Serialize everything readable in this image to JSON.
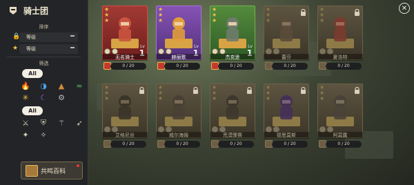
{
  "header": {
    "title": "骑士团"
  },
  "sort": {
    "section_label": "排序",
    "options": [
      {
        "label": "等级"
      },
      {
        "label": "等级"
      }
    ]
  },
  "filter": {
    "section_label": "筛选",
    "all_label_1": "All",
    "all_label_2": "All"
  },
  "wiki_button": {
    "label": "共鸣百科"
  },
  "cards": [
    {
      "name": "无名骑士",
      "level": "1",
      "progress": "0 / 20",
      "rarity": "red",
      "locked": false
    },
    {
      "name": "赫丽歌",
      "level": "1",
      "progress": "0 / 20",
      "rarity": "purple",
      "locked": false
    },
    {
      "name": "杰克逊",
      "level": "1",
      "progress": "0 / 20",
      "rarity": "green",
      "locked": false
    },
    {
      "name": "蕾芬",
      "progress": "0 / 20",
      "locked": true
    },
    {
      "name": "夏洛特",
      "progress": "0 / 20",
      "locked": true
    },
    {
      "name": "艾格尼丝",
      "progress": "0 / 20",
      "locked": true
    },
    {
      "name": "威尔海姆",
      "progress": "0 / 20",
      "locked": true
    },
    {
      "name": "荒漠骤赛",
      "progress": "0 / 20",
      "locked": true
    },
    {
      "name": "德思莫斯",
      "progress": "0 / 20",
      "locked": true
    },
    {
      "name": "阿莫露",
      "progress": "0 / 20",
      "locked": true
    }
  ],
  "lv_label": "Lv",
  "colors": {
    "red": "#a23a34",
    "purple": "#8553b5",
    "green": "#548b3d",
    "locked": "#5d5440",
    "star": "#f0c34a"
  }
}
